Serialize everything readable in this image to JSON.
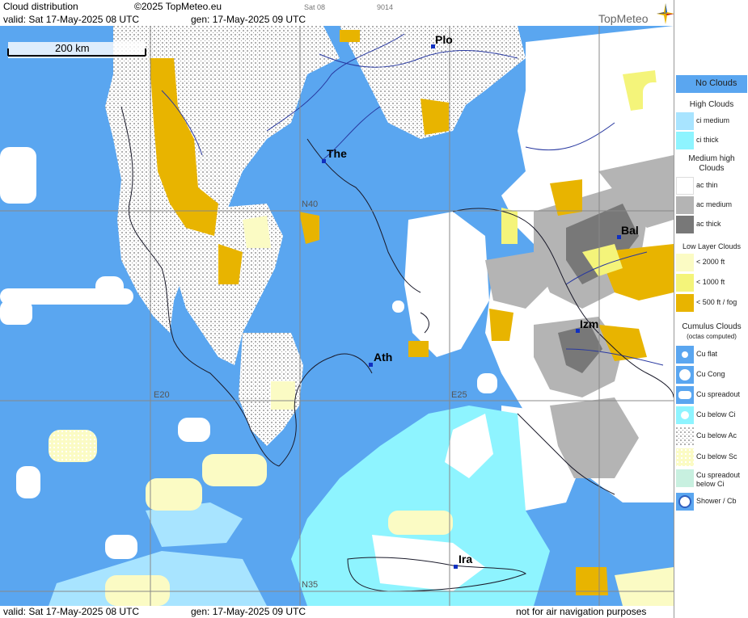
{
  "header": {
    "title": "Cloud distribution",
    "copyright": "©2025 TopMeteo.eu",
    "valid": "valid:  Sat  17-May-2025  08 UTC",
    "generated": "gen: 17-May-2025 09 UTC",
    "frame_label": "Sat 08",
    "frame_code": "9014",
    "logo": "TopMeteo"
  },
  "scale": {
    "label": "200 km"
  },
  "cities": [
    {
      "code": "Plo"
    },
    {
      "code": "The"
    },
    {
      "code": "Bal"
    },
    {
      "code": "Izm"
    },
    {
      "code": "Ath"
    },
    {
      "code": "Ira"
    }
  ],
  "grid_labels": {
    "n40": "N40",
    "n35": "N35",
    "e20": "E20",
    "e25": "E25"
  },
  "footer": {
    "valid": "valid:  Sat  17-May-2025  08 UTC",
    "generated": "gen: 17-May-2025 09 UTC",
    "disclaimer": "not for air navigation purposes"
  },
  "legend": {
    "no_clouds": "No Clouds",
    "high_clouds": "High Clouds",
    "ci_medium": "ci medium",
    "ci_thick": "ci thick",
    "medium_high": "Medium high Clouds",
    "ac_thin": "ac thin",
    "ac_medium": "ac medium",
    "ac_thick": "ac thick",
    "low_layer": "Low Layer Clouds",
    "low_2000": "< 2000 ft",
    "low_1000": "< 1000 ft",
    "low_500": "< 500 ft / fog",
    "cumulus": "Cumulus Clouds",
    "cumulus_sub": "(octas computed)",
    "cu_flat": "Cu flat",
    "cu_cong": "Cu Cong",
    "cu_spreadout": "Cu spreadout",
    "cu_below_ci": "Cu below Ci",
    "cu_below_ac": "Cu below Ac",
    "cu_below_sc": "Cu below Sc",
    "cu_spreadout_ci": "Cu spreadout below Ci",
    "shower_cb": "Shower / Cb"
  },
  "colors": {
    "no_clouds": "#5aa6f0",
    "ci_medium": "#a8e4ff",
    "ci_thick": "#8ef4ff",
    "ac_thin": "#ffffff",
    "ac_medium": "#b4b4b4",
    "ac_thick": "#787878",
    "low_2000": "#fbfbc4",
    "low_1000": "#f4f47a",
    "low_500": "#e8b400"
  }
}
